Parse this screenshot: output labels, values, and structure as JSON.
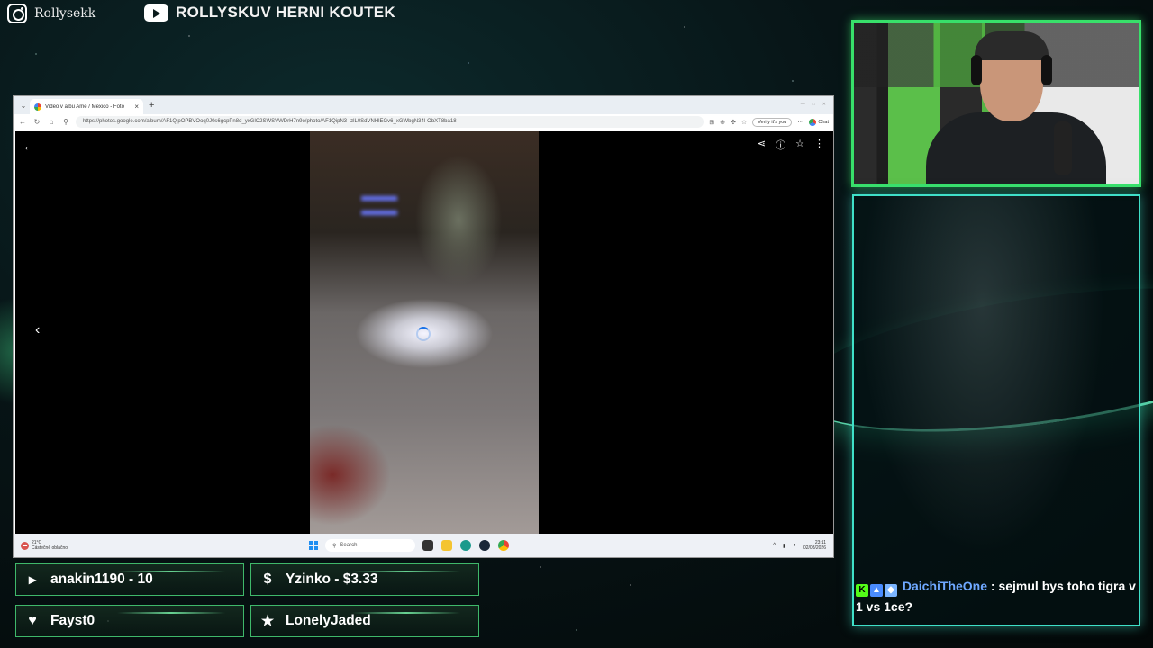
{
  "overlay": {
    "instagram_handle": "Rollysekk",
    "youtube_channel": "ROLLYSKUV HERNI KOUTEK"
  },
  "browser": {
    "tab_title": "Video v albu Ame / Mexico - Foto",
    "tab_close": "×",
    "new_tab": "+",
    "url": "https://photos.google.com/album/AF1QipOPBVOoq0J0s6gcpPn8d_yxGlC2SWSVWDrH7n9o/photo/AF1QipN3--zlL0SdVNHlEGv6_xGWbgN34l-ObXT8ba18",
    "verify_label": "Verify it's you",
    "chat_label": "Chat"
  },
  "taskbar": {
    "weather_temp": "21°C",
    "weather_desc": "Částečně oblačno",
    "search_placeholder": "Search",
    "time": "23:11",
    "date": "02/08/2026"
  },
  "chat": {
    "username": "DaichiTheOne",
    "message": ": sejmul bys toho tigra v 1 vs 1ce?"
  },
  "events": {
    "follower": "anakin1190 - 10",
    "donation": "Yzinko - $3.33",
    "like": "Fayst0",
    "star": "LonelyJaded"
  },
  "icons": {
    "instagram": "instagram-icon",
    "youtube": "youtube-icon",
    "donation": "dollar-icon",
    "like": "heart-icon",
    "star": "star-icon"
  }
}
